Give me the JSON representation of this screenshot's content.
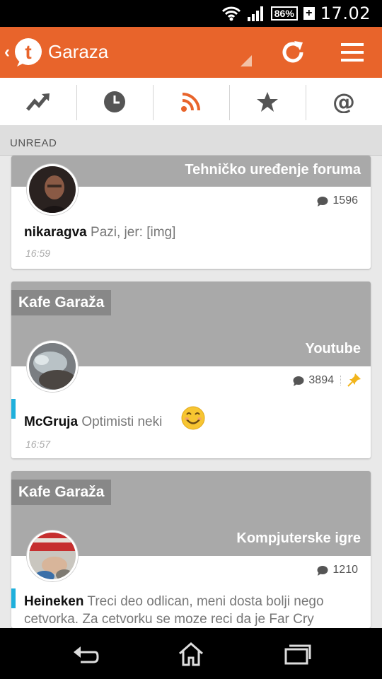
{
  "status_bar": {
    "battery": "86%",
    "time": "17.02"
  },
  "app_bar": {
    "title": "Garaza",
    "logo_letter": "t"
  },
  "section": {
    "label": "UNREAD"
  },
  "cards": [
    {
      "category": "",
      "topic": "Tehničko uređenje foruma",
      "count": "1596",
      "author": "nikaragva",
      "text": "Pazi, jer: [img]",
      "time": "16:59",
      "pinned": false
    },
    {
      "category": "Kafe Garaža",
      "topic": "Youtube",
      "count": "3894",
      "author": "McGruja",
      "text": "Optimisti neki",
      "time": "16:57",
      "pinned": true
    },
    {
      "category": "Kafe Garaža",
      "topic": "Kompjuterske igre",
      "count": "1210",
      "author": "Heineken",
      "text": "Treci deo odlican, meni dosta bolji nego cetvorka. Za cetvorku se moze reci da je Far Cry",
      "time": "",
      "pinned": false
    }
  ],
  "colors": {
    "accent": "#e8642b",
    "unread_marker": "#1fb0dc",
    "pin": "#f2b51c"
  }
}
